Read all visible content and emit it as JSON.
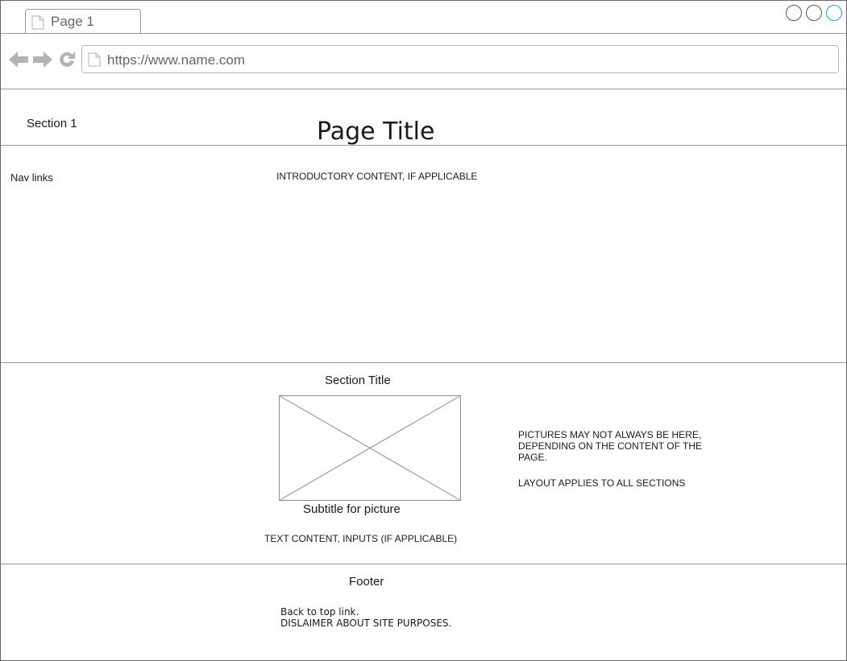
{
  "browser": {
    "tab_title": "Page 1",
    "url": "https://www.name.com"
  },
  "header": {
    "section_label": "Section 1",
    "page_title": "Page Title"
  },
  "content": {
    "nav_links": "Nav links",
    "intro": "INTRODUCTORY CONTENT, IF APPLICABLE"
  },
  "section": {
    "title": "Section Title",
    "picture_subtitle": "Subtitle for picture",
    "text_content": "TEXT CONTENT, INPUTS (IF APPLICABLE)",
    "note_line1": "PICTURES MAY NOT ALWAYS BE HERE, DEPENDING ON THE CONTENT OF THE PAGE.",
    "note_line2": "LAYOUT APPLIES TO ALL SECTIONS"
  },
  "footer": {
    "title": "Footer",
    "back_to_top": "Back to top link.",
    "disclaimer": "DISLAIMER ABOUT SITE PURPOSES."
  },
  "colors": {
    "border": "#666666",
    "divider": "#999999",
    "window_button_active": "#1ba1e2",
    "muted_icon": "#b3b3b3"
  }
}
